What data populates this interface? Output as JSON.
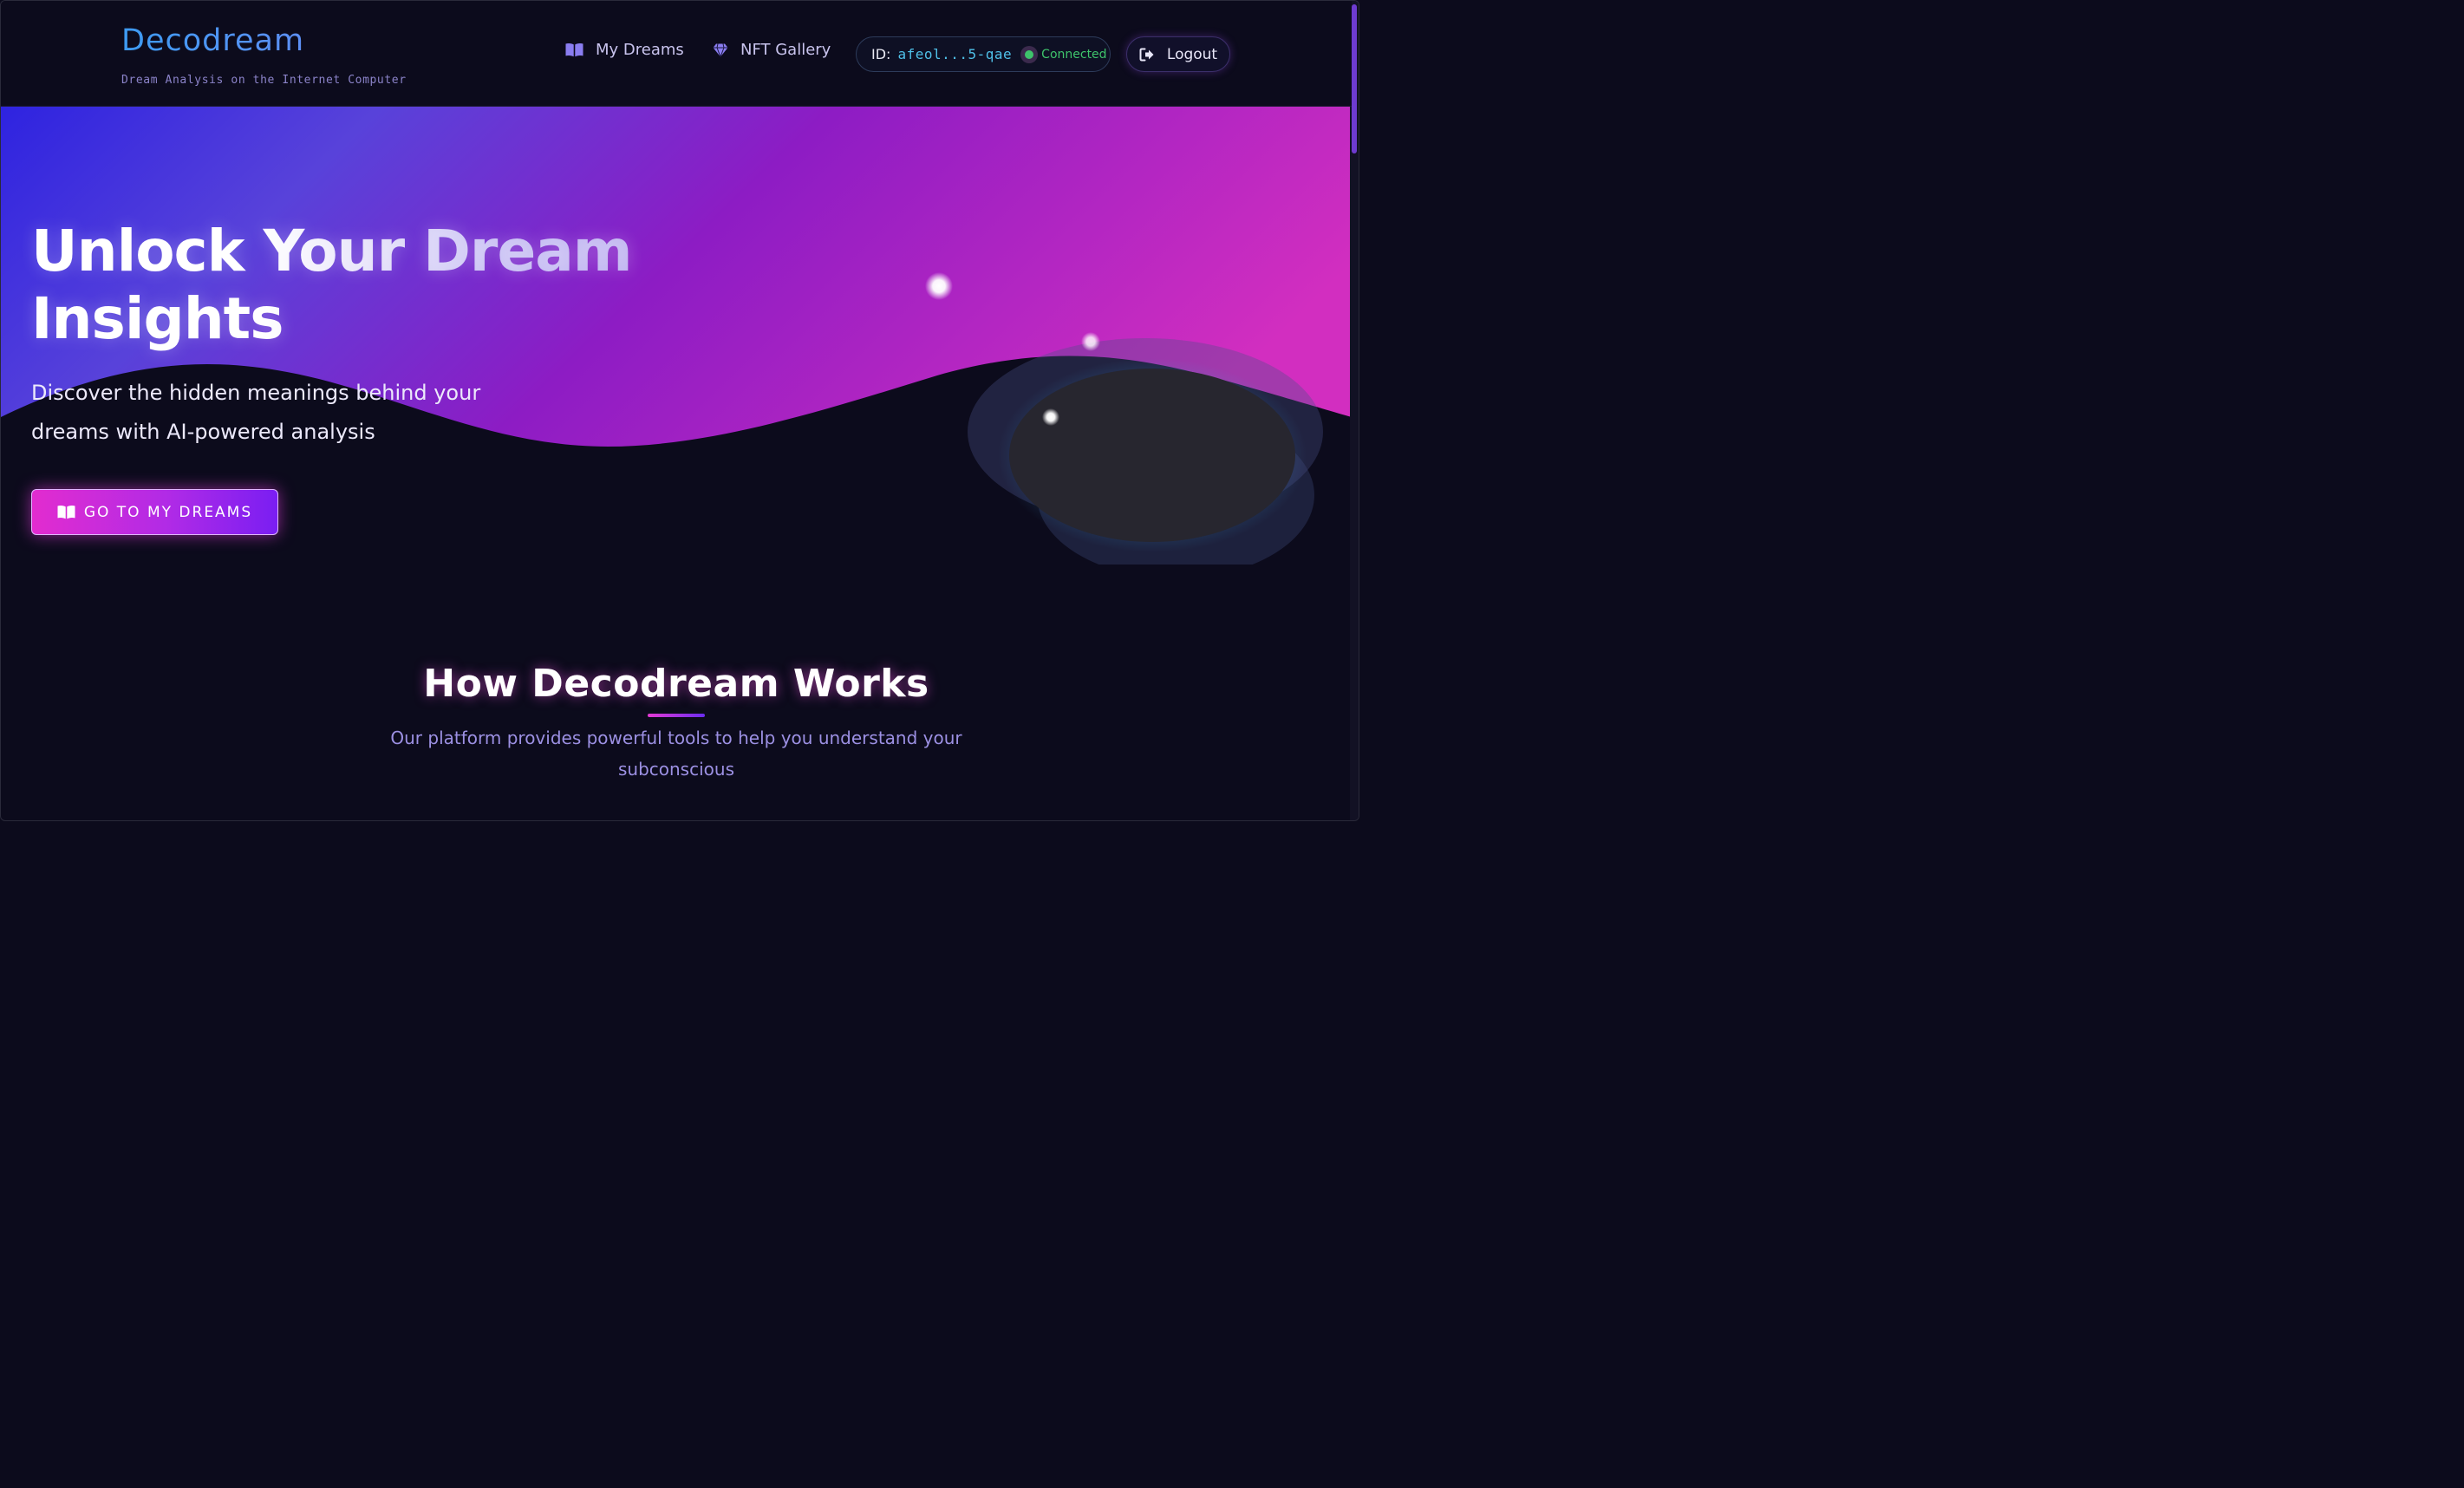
{
  "header": {
    "brand_title": "Decodream",
    "brand_subtitle": "Dream Analysis on the Internet Computer",
    "nav": {
      "my_dreams": "My Dreams",
      "nft_gallery": "NFT Gallery"
    },
    "identity": {
      "label": "ID:",
      "value": "afeol...5-qae",
      "status": "Connected"
    },
    "logout_label": "Logout"
  },
  "hero": {
    "title": "Unlock Your Dream Insights",
    "subtitle": "Discover the hidden meanings behind your dreams with AI-powered analysis",
    "cta_label": "GO TO MY DREAMS"
  },
  "how_it_works": {
    "title": "How Decodream Works",
    "subtitle": "Our platform provides powerful tools to help you understand your subconscious"
  },
  "icons": {
    "dreams": "open-book-icon",
    "gallery": "gem-icon",
    "logout": "logout-icon"
  },
  "colors": {
    "background": "#0c0b1c",
    "brand": "#4aa3f0",
    "accent_pink": "#e22ccf",
    "accent_violet": "#7a1ef2",
    "status_green": "#3ec36b",
    "id_blue": "#4fc0e8"
  }
}
